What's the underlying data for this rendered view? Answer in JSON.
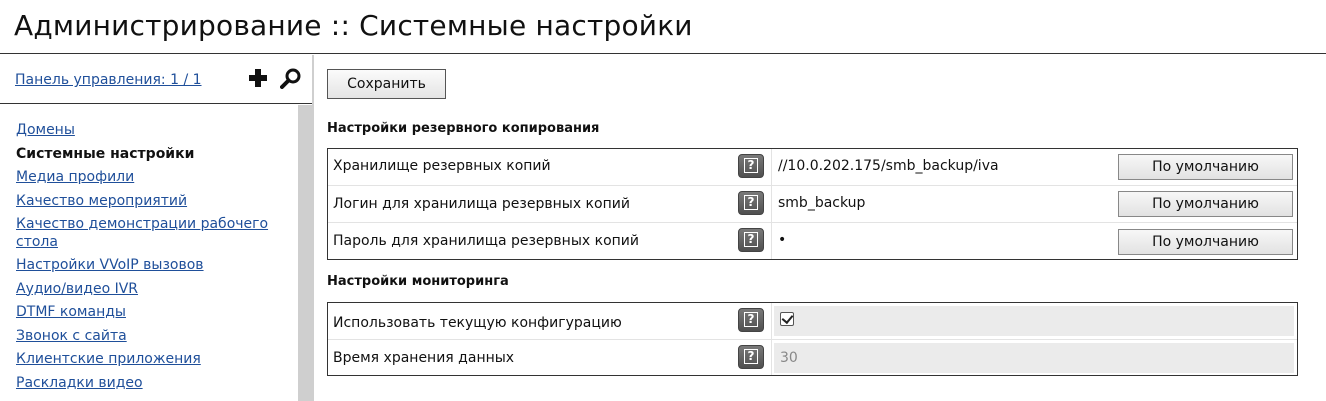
{
  "header": {
    "title": "Администрирование :: Системные настройки"
  },
  "sidebar": {
    "panel_link": "Панель управления: 1 / 1",
    "icons": [
      "plus-icon",
      "search-icon"
    ],
    "items": [
      {
        "label": "Домены",
        "active": false
      },
      {
        "label": "Системные настройки",
        "active": true
      },
      {
        "label": "Медиа профили",
        "active": false
      },
      {
        "label": "Качество мероприятий",
        "active": false
      },
      {
        "label": "Качество демонстрации рабочего стола",
        "active": false
      },
      {
        "label": "Настройки VVoIP вызовов",
        "active": false
      },
      {
        "label": "Аудио/видео IVR",
        "active": false
      },
      {
        "label": "DTMF команды",
        "active": false
      },
      {
        "label": "Звонок с сайта",
        "active": false
      },
      {
        "label": "Клиентские приложения",
        "active": false
      },
      {
        "label": "Раскладки видео",
        "active": false
      }
    ]
  },
  "main": {
    "save_label": "Сохранить",
    "backup": {
      "title": "Настройки резервного копирования",
      "rows": [
        {
          "label": "Хранилище резервных копий",
          "value": "//10.0.202.175/smb_backup/iva",
          "default_label": "По умолчанию"
        },
        {
          "label": "Логин для хранилища резервных копий",
          "value": "smb_backup",
          "default_label": "По умолчанию"
        },
        {
          "label": "Пароль для хранилища резервных копий",
          "value": "•",
          "default_label": "По умолчанию"
        }
      ]
    },
    "monitoring": {
      "title": "Настройки мониторинга",
      "rows": [
        {
          "label": "Использовать текущую конфигурацию",
          "checked": true
        },
        {
          "label": "Время хранения данных",
          "value": "30"
        }
      ]
    },
    "help_glyph": "?"
  },
  "colors": {
    "link": "#1f4f9a",
    "help_button": "#5a5a5a",
    "disabled_bg": "#ebebeb"
  }
}
